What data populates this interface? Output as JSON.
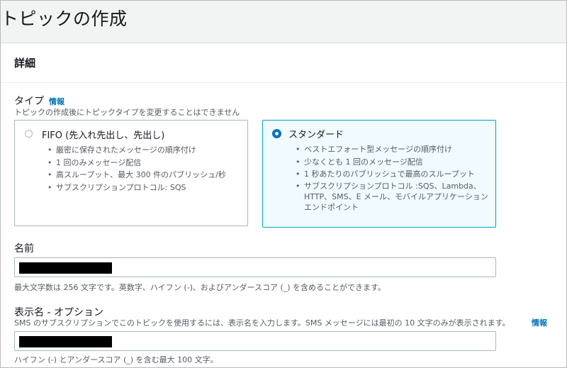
{
  "page": {
    "title": "トピックの作成"
  },
  "panel": {
    "title": "詳細"
  },
  "type_section": {
    "label": "タイプ",
    "info": "情報",
    "description": "トピックの作成後にトピックタイプを変更することはできません"
  },
  "options": [
    {
      "title": "FIFO (先入れ先出し、先出し)",
      "selected": false,
      "bullets": [
        "厳密に保存されたメッセージの順序付け",
        "1 回のみメッセージ配信",
        "高スループット、最大 300 件のパブリッシュ/秒",
        "サブスクリプションプロトコル: SQS"
      ]
    },
    {
      "title": "スタンダード",
      "selected": true,
      "bullets": [
        "ベストエフォート型メッセージの順序付け",
        "少なくとも 1 回のメッセージ配信",
        "1 秒あたりのパブリッシュで最高のスループット",
        "サブスクリプションプロトコル :SQS、Lambda、HTTP、SMS、E メール、モバイルアプリケーションエンドポイント"
      ]
    }
  ],
  "name_field": {
    "label": "名前",
    "hint": "最大文字数は 256 文字です。英数字、ハイフン (-)、およびアンダースコア (_) を含めることができます。"
  },
  "display_field": {
    "label": "表示名 - オプション",
    "description": "SMS のサブスクリプションでこのトピックを使用するには、表示名を入力します。SMS メッセージには最初の 10 文字のみが表示されます。",
    "info": "情報",
    "hint": "ハイフン (-) とアンダースコア (_) を含む最大 100 文字。"
  },
  "colors": {
    "accent": "#0073bb",
    "selected_border": "#00a1c9",
    "selected_bg": "#f1faff"
  }
}
